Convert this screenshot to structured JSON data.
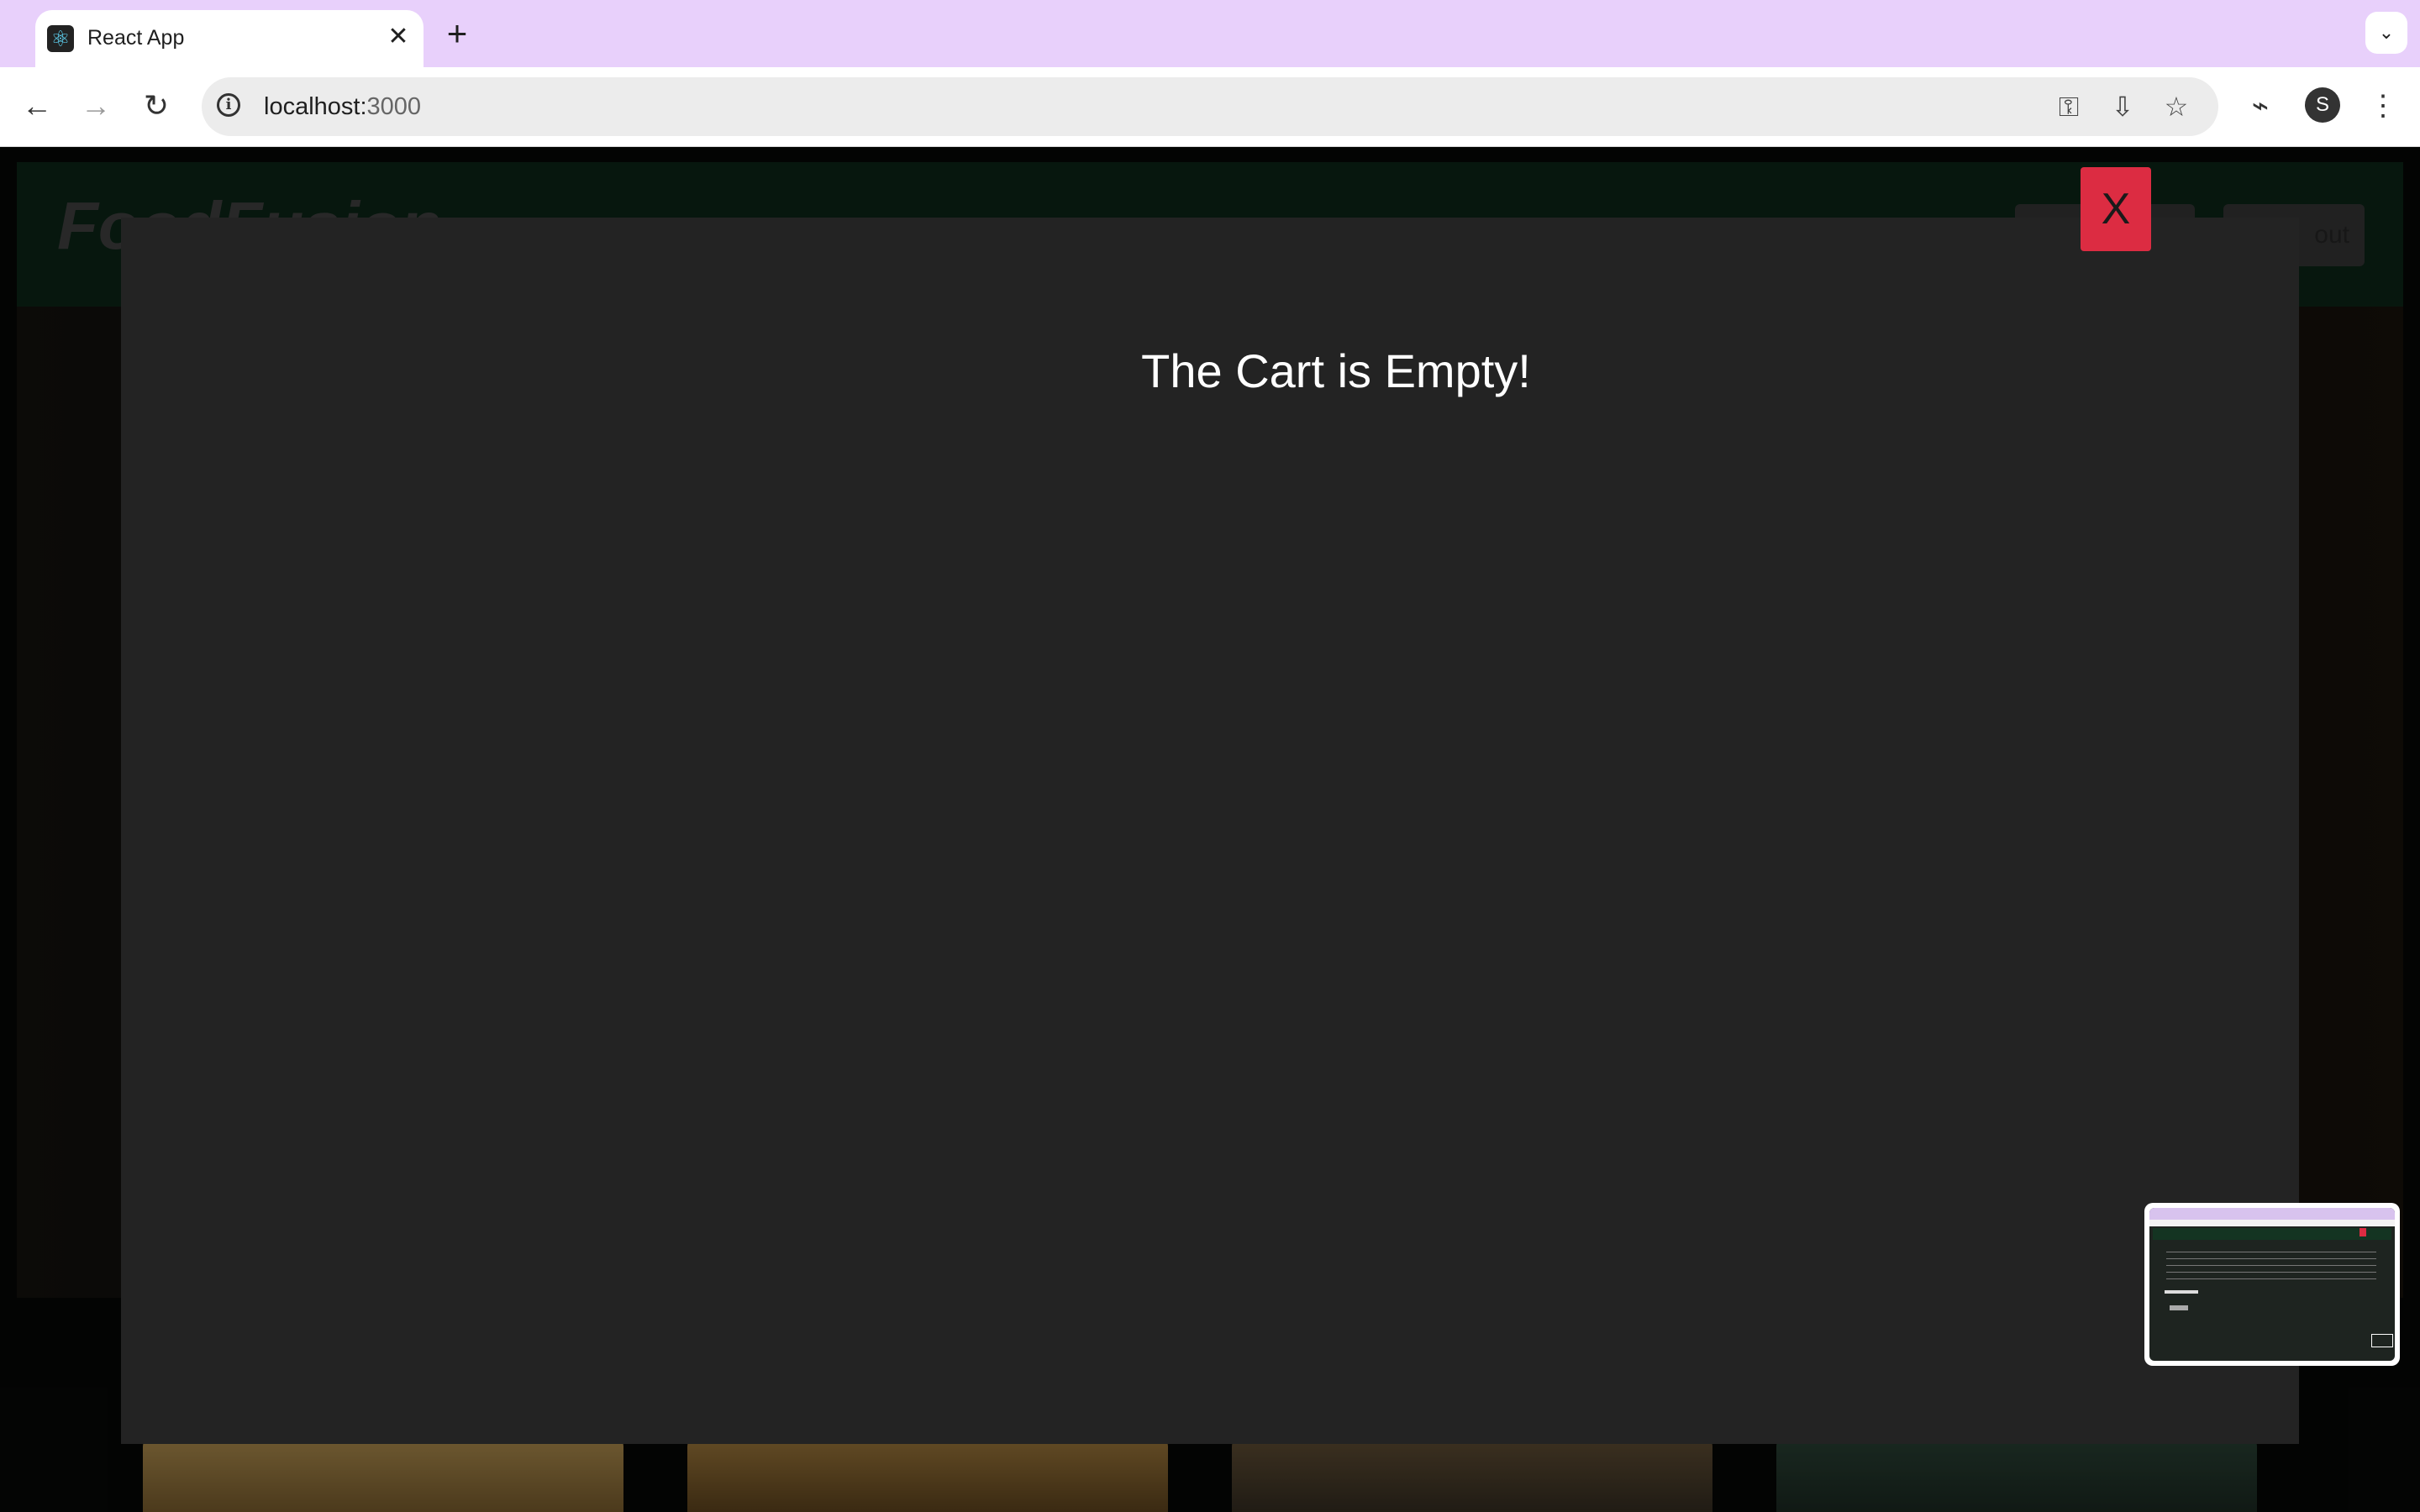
{
  "browser": {
    "tab_title": "React App",
    "tab_close": "✕",
    "new_tab": "+",
    "tab_menu": "⌄",
    "url_host": "localhost:",
    "url_port": "3000",
    "profile_initial": "S"
  },
  "app": {
    "brand": "FoodFusion",
    "header_button_2": "out"
  },
  "cart_modal": {
    "message": "The Cart is Empty!",
    "close_label": "X"
  },
  "colors": {
    "tab_strip": "#e8d0fb",
    "modal_bg": "#232323",
    "close_button": "#dc2c42",
    "header_green": "#0d2a1a"
  }
}
